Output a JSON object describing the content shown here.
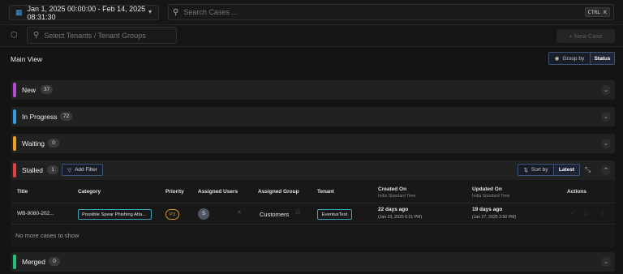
{
  "topbar": {
    "date_range": "Jan 1, 2025 00:00:00 - Feb 14, 2025 08:31:30",
    "search_placeholder": "Search Cases ...",
    "search_shortcut": "CTRL K"
  },
  "toolbar": {
    "tenant_placeholder": "Select Tenants / Tenant Groups",
    "new_case_label": "+ New Case"
  },
  "view": {
    "title": "Main View",
    "group_by_label": "Group by",
    "group_by_value": "Status"
  },
  "sections": [
    {
      "label": "New",
      "count": "37",
      "color": "#b44cd6"
    },
    {
      "label": "In Progress",
      "count": "72",
      "color": "#2e9fe0"
    },
    {
      "label": "Waiting",
      "count": "0",
      "color": "#f0a020"
    },
    {
      "label": "Stalled",
      "count": "1",
      "color": "#e04040"
    },
    {
      "label": "Merged",
      "count": "0",
      "color": "#22c07a"
    }
  ],
  "stalled": {
    "add_filter_label": "Add Filter",
    "sort_by_label": "Sort by",
    "sort_by_value": "Latest",
    "columns": {
      "title": "Title",
      "category": "Category",
      "priority": "Priority",
      "assigned_users": "Assigned Users",
      "assigned_group": "Assigned Group",
      "tenant": "Tenant",
      "created_on": "Created On",
      "created_on_sub": "India Standard Time",
      "updated_on": "Updated On",
      "updated_on_sub": "India Standard Time",
      "actions": "Actions"
    },
    "rows": [
      {
        "title": "WB-9080-202...",
        "category": "Possible Spear Phishing Atta...",
        "priority": "P3",
        "assigned_user_initial": "S",
        "assigned_group": "Customers",
        "tenant": "EventusTest",
        "created_rel": "22 days ago",
        "created_abs": "(Jan 23, 2025 6:21 PM)",
        "updated_rel": "19 days ago",
        "updated_abs": "(Jan 27, 2025 3:50 PM)"
      }
    ],
    "empty_message": "No more cases to show"
  },
  "colors": {
    "accent_blue": "#3c5276",
    "teal_border": "#3aa6b9",
    "priority_amber": "#d49a1d"
  }
}
